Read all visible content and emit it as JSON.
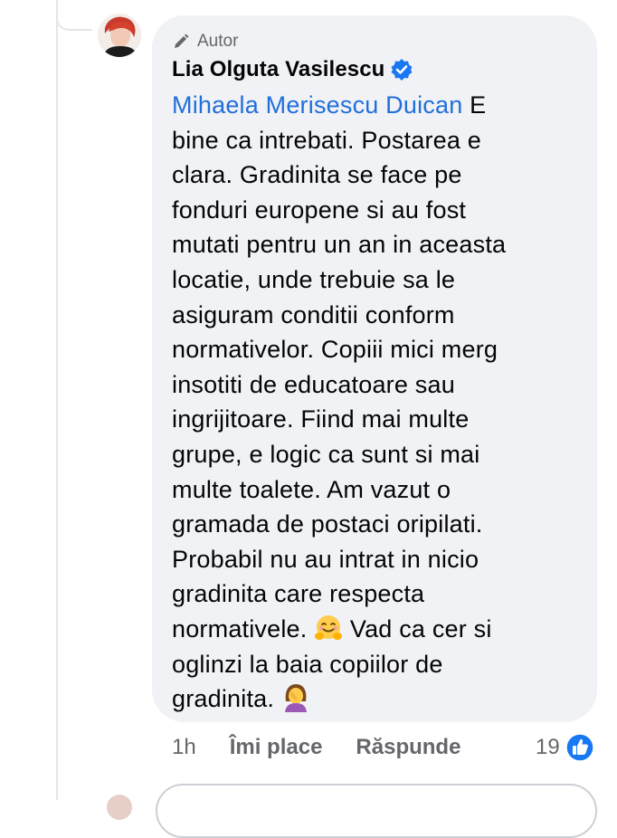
{
  "comment": {
    "badge_label": "Autor",
    "author_name": "Lia Olguta Vasilescu",
    "mention": "Mihaela Merisescu Duican",
    "text_lines": [
      " E",
      "bine ca intrebati. Postarea e",
      "clara. Gradinita se face pe",
      "fonduri europene si au fost",
      "mutati pentru un an in aceasta",
      "locatie, unde trebuie sa le",
      "asiguram conditii conform",
      "normativelor. Copiii mici merg",
      "insotiti de educatoare sau",
      "ingrijitoare. Fiind mai multe",
      "grupe, e logic ca sunt si mai",
      "multe toalete. Am vazut o",
      "gramada de postaci oripilati.",
      "Probabil nu au intrat in nicio",
      "gradinita care respecta",
      "normativele.",
      " Vad ca cer si",
      "oglinzi la baia copiilor de",
      "gradinita."
    ]
  },
  "actions": {
    "time": "1h",
    "like_label": "Îmi place",
    "reply_label": "Răspunde",
    "reaction_count": "19"
  },
  "icons": {
    "badge": "pencil-icon",
    "verified": "verified-badge-icon",
    "emoji_1": "hugging-face-emoji",
    "emoji_2": "facepalm-woman-emoji",
    "reaction": "like-reaction-icon"
  },
  "colors": {
    "bubble": "#f0f2f5",
    "mention": "#216fdb",
    "verified": "#1877f2",
    "meta_text": "#65676b"
  }
}
